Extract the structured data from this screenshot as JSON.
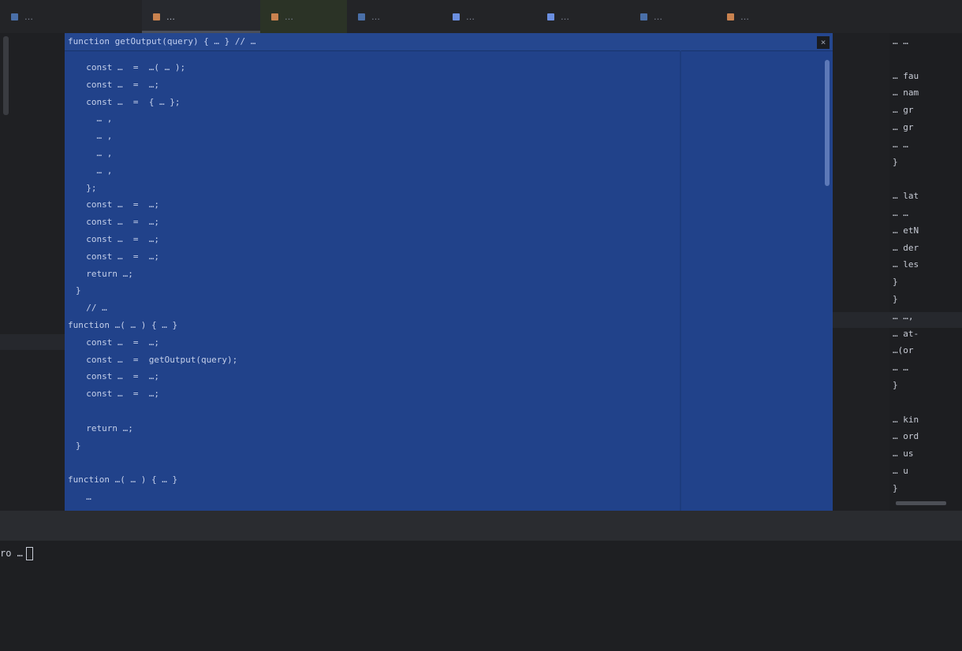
{
  "tabs": [
    {
      "label": "…",
      "icon_color": "#4a6fa8"
    },
    {
      "label": "…",
      "icon_color": "#c9824f"
    },
    {
      "label": "…",
      "icon_color": "#c9824f"
    },
    {
      "label": "…",
      "icon_color": "#4a6fa8"
    },
    {
      "label": "…",
      "icon_color": "#6b8fe0"
    },
    {
      "label": "…",
      "icon_color": "#6b8fe0"
    },
    {
      "label": "…",
      "icon_color": "#4a6fa8"
    },
    {
      "label": "…",
      "icon_color": "#c9824f"
    }
  ],
  "editor": {
    "header": "function getOutput(query) { … } // …",
    "close_glyph": "×",
    "lines": [
      "  const …  =  …( … );",
      "  const …  =  …;",
      "  const …  =  { … };",
      "    … ,",
      "    … ,",
      "    … ,",
      "    … ,",
      "  };",
      "  const …  =  …;",
      "  const …  =  …;",
      "  const …  =  …;",
      "  const …  =  …;",
      "  return …;",
      "}",
      "  // …",
      "function …( … ) { … }",
      "  const …  =  …;",
      "  const …  =  getOutput(query);",
      "  const …  =  …;",
      "  const …  =  …;",
      "",
      "  return …;",
      "}",
      "",
      "function …( … ) { … }",
      "  …"
    ],
    "line_numbers": [
      "",
      "",
      "",
      "",
      "",
      "",
      "",
      "",
      "",
      "",
      "",
      "",
      "",
      "",
      "",
      "",
      "",
      "",
      "",
      "",
      "",
      "",
      "",
      "",
      "",
      ""
    ]
  },
  "right_pane": {
    "lines": [
      "… …",
      "",
      "… fau",
      "… nam",
      "… gr",
      "… gr",
      "… …",
      "}",
      "",
      "… lat",
      "… …",
      "… etN",
      "… der",
      "… les",
      "}",
      "}",
      "… …,",
      "… at-",
      "…(or",
      "… …",
      "}",
      "",
      "… kin",
      "… ord",
      "… us",
      "… u",
      "}"
    ]
  },
  "terminal": {
    "prompt": "ro …"
  }
}
